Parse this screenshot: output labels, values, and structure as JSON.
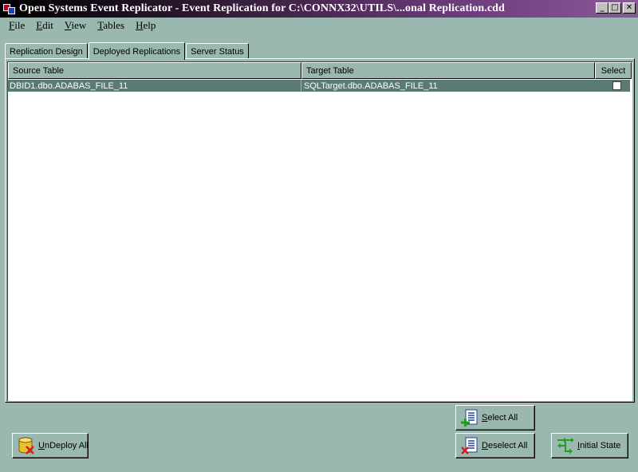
{
  "window": {
    "title": "Open Systems Event Replicator - Event Replication for C:\\CONNX32\\UTILS\\...onal Replication.cdd",
    "minimize": "_",
    "maximize": "□",
    "close": "✕"
  },
  "menu": [
    {
      "ul": "F",
      "rest": "ile"
    },
    {
      "ul": "E",
      "rest": "dit"
    },
    {
      "ul": "V",
      "rest": "iew"
    },
    {
      "ul": "T",
      "rest": "ables"
    },
    {
      "ul": "H",
      "rest": "elp"
    }
  ],
  "tabs": [
    {
      "label": "Replication Design"
    },
    {
      "label": "Deployed Replications"
    },
    {
      "label": "Server Status"
    }
  ],
  "grid": {
    "columns": [
      "Source Table",
      "Target Table",
      "Select"
    ],
    "rows": [
      {
        "source": "DBID1.dbo.ADABAS_FILE_11",
        "target": "SQLTarget.dbo.ADABAS_FILE_11",
        "selected": false
      }
    ]
  },
  "buttons": {
    "select_all": {
      "ul": "S",
      "rest": "elect All"
    },
    "deselect_all": {
      "ul": "D",
      "rest": "eselect All"
    },
    "initial_state": {
      "ul": "I",
      "rest": "nitial State"
    },
    "undeploy_all": {
      "ul": "U",
      "rest": "nDeploy All"
    }
  },
  "colors": {
    "background": "#9ab8b0",
    "selected_row": "#5a7a74",
    "title_gradient_end": "#8a5a98"
  }
}
